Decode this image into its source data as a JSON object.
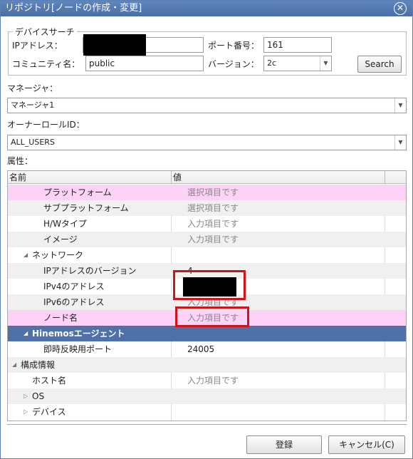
{
  "window": {
    "title": "リポジトリ[ノードの作成・変更]",
    "close_symbol": "✕"
  },
  "device_search": {
    "legend": "デバイスサーチ",
    "ip_label": "IPアドレス：",
    "ip_value": "",
    "port_label": "ポート番号：",
    "port_value": "161",
    "community_label": "コミュニティ名：",
    "community_value": "public",
    "version_label": "バージョン：",
    "version_value": "2c",
    "search_button": "Search"
  },
  "manager": {
    "label": "マネージャ：",
    "value": "マネージャ1"
  },
  "owner_role": {
    "label": "オーナーロールID：",
    "value": "ALL_USERS"
  },
  "attributes": {
    "label": "属性：",
    "columns": [
      "名前",
      "値"
    ],
    "rows": [
      {
        "name": "プラットフォーム",
        "value": "選択項目です"
      },
      {
        "name": "サブプラットフォーム",
        "value": "選択項目です"
      },
      {
        "name": "H/Wタイプ",
        "value": "入力項目です"
      },
      {
        "name": "イメージ",
        "value": "入力項目です"
      },
      {
        "name": "ネットワーク",
        "value": ""
      },
      {
        "name": "IPアドレスのバージョン",
        "value": "4"
      },
      {
        "name": "IPv4のアドレス",
        "value": ""
      },
      {
        "name": "IPv6のアドレス",
        "value": "入力項目です"
      },
      {
        "name": "ノード名",
        "value": "入力項目です"
      },
      {
        "name": "Hinemosエージェント",
        "value": ""
      },
      {
        "name": "即時反映用ポート",
        "value": "24005"
      },
      {
        "name": "構成情報",
        "value": ""
      },
      {
        "name": "ホスト名",
        "value": "入力項目です"
      },
      {
        "name": "OS",
        "value": ""
      },
      {
        "name": "デバイス",
        "value": ""
      }
    ]
  },
  "footer": {
    "register_button": "登録",
    "cancel_button": "キャンセル(C)"
  },
  "colors": {
    "title_bar": "#4a6fa5",
    "required_row": "#fdd2f7",
    "selected_row": "#5070a8",
    "highlight_box": "#d0141c"
  }
}
